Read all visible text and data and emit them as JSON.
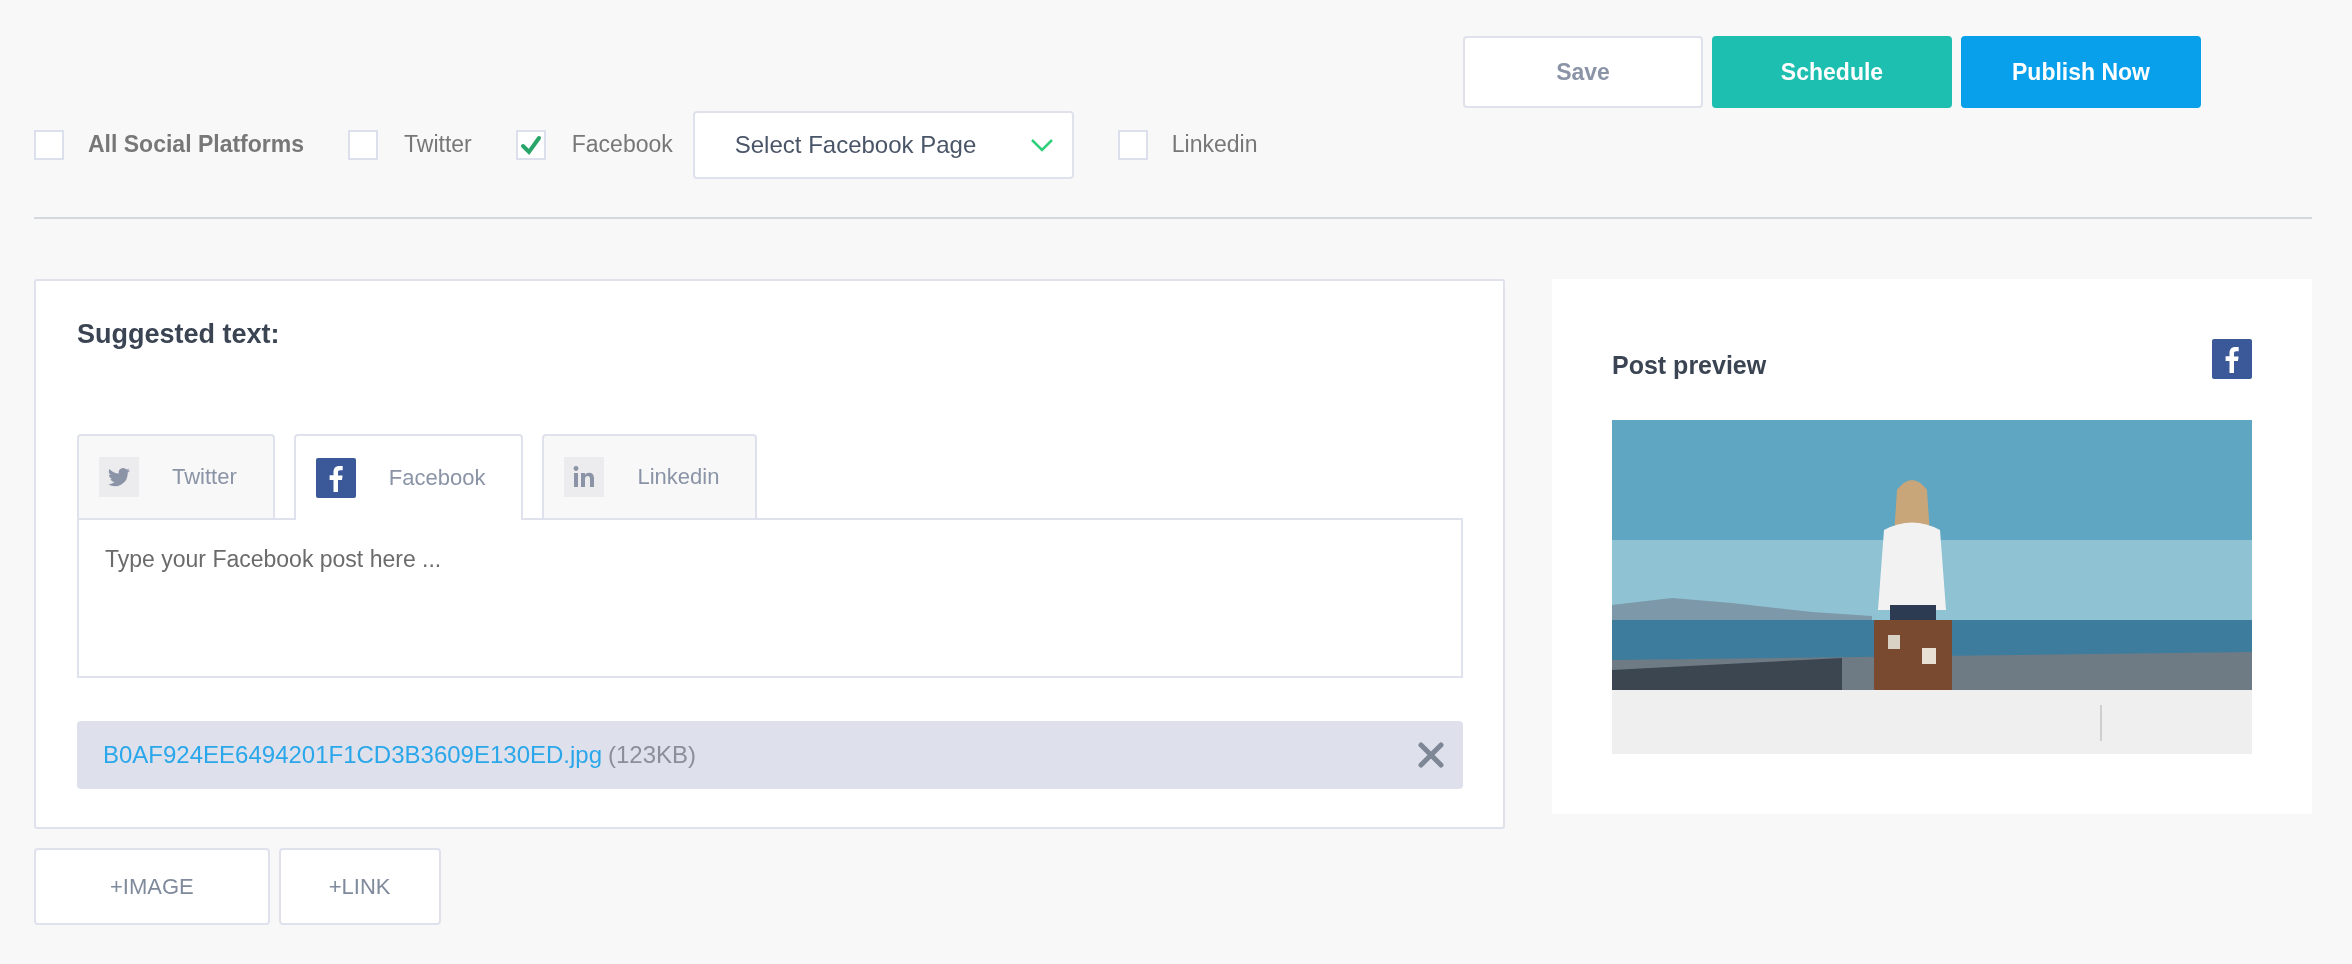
{
  "actions": [
    {
      "label": "Save",
      "kind": "secondary"
    },
    {
      "label": "Schedule",
      "kind": "schedule"
    },
    {
      "label": "Publish Now",
      "kind": "primary"
    }
  ],
  "platforms": [
    {
      "label": "All Social Platforms",
      "checked": false,
      "kind": "all"
    },
    {
      "label": "Twitter",
      "checked": false,
      "kind": "network"
    },
    {
      "label": "Facebook",
      "checked": true,
      "kind": "network",
      "page_select": "Select Facebook Page"
    },
    {
      "label": "Linkedin",
      "checked": false,
      "kind": "network"
    }
  ],
  "composer": {
    "title": "Suggested text:",
    "tabs": [
      {
        "label": "Twitter",
        "kind": "twitter",
        "selected": false
      },
      {
        "label": "Facebook",
        "kind": "facebook",
        "selected": true
      },
      {
        "label": "Linkedin",
        "kind": "linkedin",
        "selected": false
      }
    ],
    "placeholder": "Type your Facebook post here ...",
    "attachment": {
      "filename": "B0AF924EE6494201F1CD3B3609E130ED.jpg",
      "size": "(123KB)"
    }
  },
  "add_buttons": [
    "+IMAGE",
    "+LINK"
  ],
  "preview": {
    "title": "Post preview",
    "kind": "facebook"
  }
}
